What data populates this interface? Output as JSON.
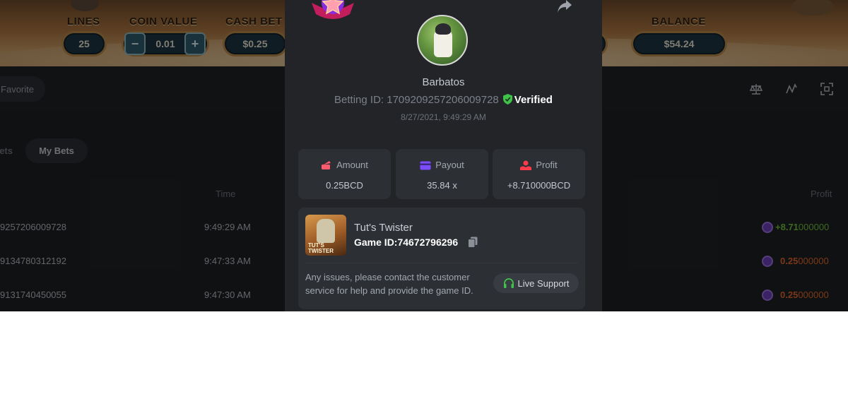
{
  "game_hud": {
    "lines_label": "LINES",
    "lines_value": "25",
    "coin_value_label": "COIN VALUE",
    "coin_value": "0.01",
    "minus_symbol": "−",
    "plus_symbol": "+",
    "cash_bet_label": "CASH BET",
    "cash_bet_value": "$0.25",
    "balance_label": "BALANCE",
    "balance_value": "$54.24"
  },
  "toolbar": {
    "favorite_label": "Favorite",
    "icons": [
      "scale-icon",
      "chart-icon",
      "fullscreen-icon"
    ]
  },
  "listing": {
    "tabs": [
      {
        "label": "Bets",
        "visible_text": "ets",
        "active": false
      },
      {
        "label": "My Bets",
        "active": true
      }
    ],
    "columns": [
      "Time",
      "Profit"
    ],
    "rows": [
      {
        "id_fragment": "9257206009728",
        "time": "9:49:29 AM",
        "profit_main": "+8.71",
        "profit_tail": "000000",
        "color": "#6fbf3a"
      },
      {
        "id_fragment": "9134780312192",
        "time": "9:47:33 AM",
        "profit_main": "0.25",
        "profit_tail": "000000",
        "color": "#e0662a"
      },
      {
        "id_fragment": "9131740450055",
        "time": "9:47:30 AM",
        "profit_main": "0.25",
        "profit_tail": "000000",
        "color": "#e0662a"
      }
    ]
  },
  "bet_detail": {
    "username": "Barbatos",
    "betting_id_label": "Betting ID:",
    "betting_id": "1709209257206009728",
    "verified_label": "Verified",
    "datetime": "8/27/2021, 9:49:29 AM",
    "stats": [
      {
        "label": "Amount",
        "value": "0.25BCD",
        "icon": "amount-icon",
        "color": "#ff5a6e"
      },
      {
        "label": "Payout",
        "value": "35.84 x",
        "icon": "payout-card-icon",
        "color": "#7b4dff"
      },
      {
        "label": "Profit",
        "value": "+8.710000BCD",
        "icon": "profit-hand-icon",
        "color": "#ff3a4a"
      }
    ],
    "game": {
      "name": "Tut's Twister",
      "thumb_text_line1": "TUT'S",
      "thumb_text_line2": "TWISTER",
      "game_id_label": "Game ID:",
      "game_id": "74672796296"
    },
    "support_note": "Any issues, please contact the customer service for help and provide the game ID.",
    "live_support_label": "Live Support"
  },
  "colors": {
    "accent_green": "#3fc24a",
    "modal_bg": "#222428",
    "card_bg": "#2c2f34"
  }
}
